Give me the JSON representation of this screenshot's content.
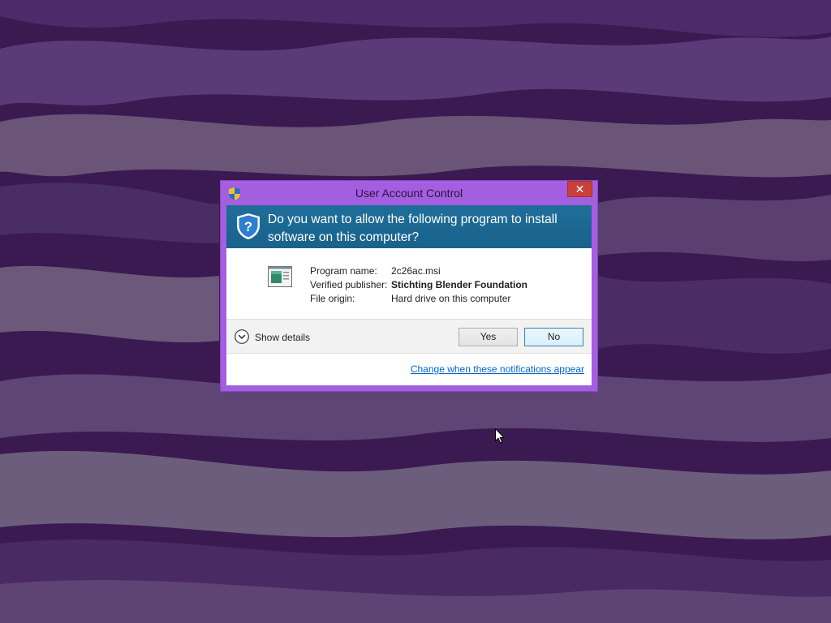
{
  "window": {
    "title": "User Account Control",
    "close_glyph": "✕"
  },
  "header": {
    "question": "Do you want to allow the following program to install software on this computer?"
  },
  "program_info": {
    "program_name_label": "Program name:",
    "program_name_value": "2c26ac.msi",
    "publisher_label": "Verified publisher:",
    "publisher_value": "Stichting Blender Foundation",
    "origin_label": "File origin:",
    "origin_value": "Hard drive on this computer"
  },
  "details": {
    "show_details_label": "Show details"
  },
  "buttons": {
    "yes_label": "Yes",
    "no_label": "No"
  },
  "footer": {
    "change_link_label": "Change when these notifications appear"
  },
  "icons": {
    "title_icon": "uac-shield-icon",
    "header_icon": "shield-question-icon",
    "program_icon": "installer-package-icon",
    "details_icon": "chevron-down-icon",
    "close_icon": "close-icon",
    "cursor": "mouse-pointer-icon"
  },
  "colors": {
    "window_frame": "#a45ee0",
    "header_band": "#1f6e9a",
    "close_button": "#c9403a",
    "link": "#0066cc",
    "desktop_base": "#3b1a52"
  }
}
